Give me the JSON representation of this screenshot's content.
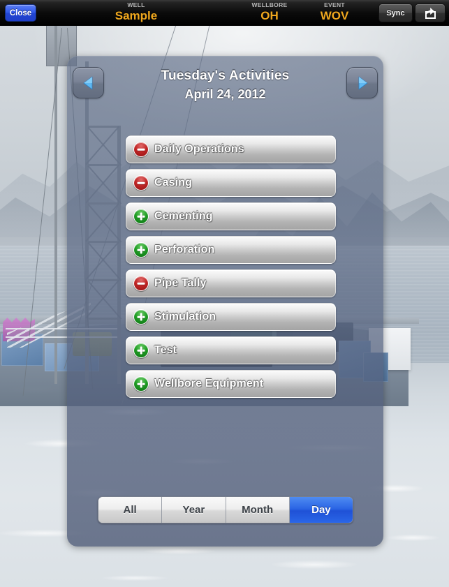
{
  "topbar": {
    "close_label": "Close",
    "fields": [
      {
        "caption": "WELL",
        "value": "Sample"
      },
      {
        "caption": "WELLBORE",
        "value": "OH"
      },
      {
        "caption": "EVENT",
        "value": "WOV"
      }
    ],
    "sync_label": "Sync",
    "share_icon": "share-export-icon",
    "accent_value_color": "#f0a81e",
    "close_button_color": "#2f57e8"
  },
  "panel": {
    "prev_icon": "chevron-left-icon",
    "next_icon": "chevron-right-icon",
    "title": "Tuesday's Activities",
    "subtitle": "April 24, 2012",
    "activities": [
      {
        "label": "Daily Operations",
        "icon": "minus-circle-icon",
        "state": "minus"
      },
      {
        "label": "Casing",
        "icon": "minus-circle-icon",
        "state": "minus"
      },
      {
        "label": "Cementing",
        "icon": "plus-circle-icon",
        "state": "plus"
      },
      {
        "label": "Perforation",
        "icon": "plus-circle-icon",
        "state": "plus"
      },
      {
        "label": "Pipe Tally",
        "icon": "minus-circle-icon",
        "state": "minus"
      },
      {
        "label": "Stimulation",
        "icon": "plus-circle-icon",
        "state": "plus"
      },
      {
        "label": "Test",
        "icon": "plus-circle-icon",
        "state": "plus"
      },
      {
        "label": "Wellbore Equipment",
        "icon": "plus-circle-icon",
        "state": "plus"
      }
    ],
    "range_filter": {
      "options": [
        "All",
        "Year",
        "Month",
        "Day"
      ],
      "selected": "Day",
      "selected_color": "#2a64e4"
    }
  },
  "colors": {
    "minus_icon": "#c02525",
    "plus_icon": "#1f9c24",
    "panel_overlay": "#5a6884",
    "nav_arrow": "#58b6f0"
  }
}
